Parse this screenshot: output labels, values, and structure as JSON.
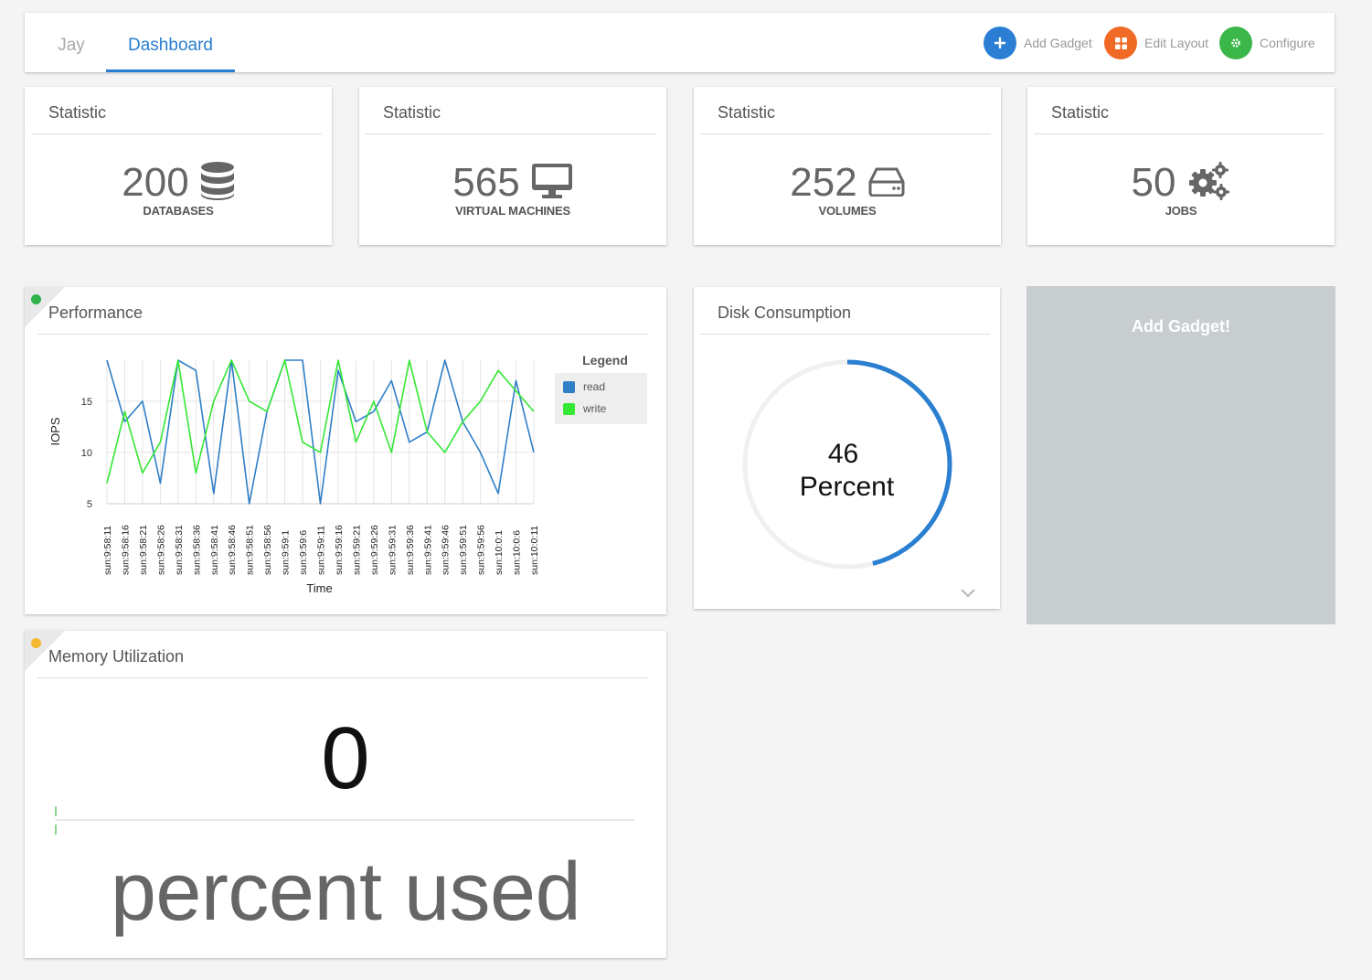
{
  "header": {
    "tabs": [
      {
        "label": "Jay"
      },
      {
        "label": "Dashboard"
      }
    ],
    "buttons": {
      "add_gadget": "Add Gadget",
      "edit_layout": "Edit Layout",
      "configure": "Configure"
    }
  },
  "stats": [
    {
      "title": "Statistic",
      "value": "200",
      "label": "DATABASES",
      "icon": "database-icon"
    },
    {
      "title": "Statistic",
      "value": "565",
      "label": "VIRTUAL MACHINES",
      "icon": "monitor-icon"
    },
    {
      "title": "Statistic",
      "value": "252",
      "label": "VOLUMES",
      "icon": "hard-drive-icon"
    },
    {
      "title": "Statistic",
      "value": "50",
      "label": "JOBS",
      "icon": "gears-icon"
    }
  ],
  "performance": {
    "title": "Performance",
    "status_color": "#2db34a",
    "legend_title": "Legend"
  },
  "chart_data": {
    "type": "line",
    "xlabel": "Time",
    "ylabel": "IOPS",
    "ylim": [
      5,
      19
    ],
    "yticks": [
      5,
      10,
      15
    ],
    "grid": true,
    "legend_position": "right",
    "categories": [
      "sun:9:58:11",
      "sun:9:58:16",
      "sun:9:58:21",
      "sun:9:58:26",
      "sun:9:58:31",
      "sun:9:58:36",
      "sun:9:58:41",
      "sun:9:58:46",
      "sun:9:58:51",
      "sun:9:58:56",
      "sun:9:59:1",
      "sun:9:59:6",
      "sun:9:59:11",
      "sun:9:59:16",
      "sun:9:59:21",
      "sun:9:59:26",
      "sun:9:59:31",
      "sun:9:59:36",
      "sun:9:59:41",
      "sun:9:59:46",
      "sun:9:59:51",
      "sun:9:59:56",
      "sun:10:0:1",
      "sun:10:0:6",
      "sun:10:0:11"
    ],
    "series": [
      {
        "name": "read",
        "color": "#2f7fc6",
        "values": [
          19,
          13,
          15,
          7,
          19,
          18,
          6,
          19,
          5,
          14,
          19,
          19,
          5,
          18,
          13,
          14,
          17,
          11,
          12,
          19,
          13,
          10,
          6,
          17,
          10
        ]
      },
      {
        "name": "write",
        "color": "#34e834",
        "values": [
          7,
          14,
          8,
          11,
          19,
          8,
          15,
          19,
          15,
          14,
          19,
          11,
          10,
          19,
          11,
          15,
          10,
          19,
          12,
          10,
          13,
          15,
          18,
          16,
          14
        ]
      }
    ]
  },
  "disk": {
    "title": "Disk Consumption",
    "value": "46",
    "unit": "Percent",
    "percent": 46,
    "ring_color": "#2a7fd0"
  },
  "add_gadget_panel": {
    "title": "Add Gadget!"
  },
  "memory": {
    "title": "Memory Utilization",
    "status_color": "#f5b731",
    "value": "0",
    "unit": "percent used"
  }
}
